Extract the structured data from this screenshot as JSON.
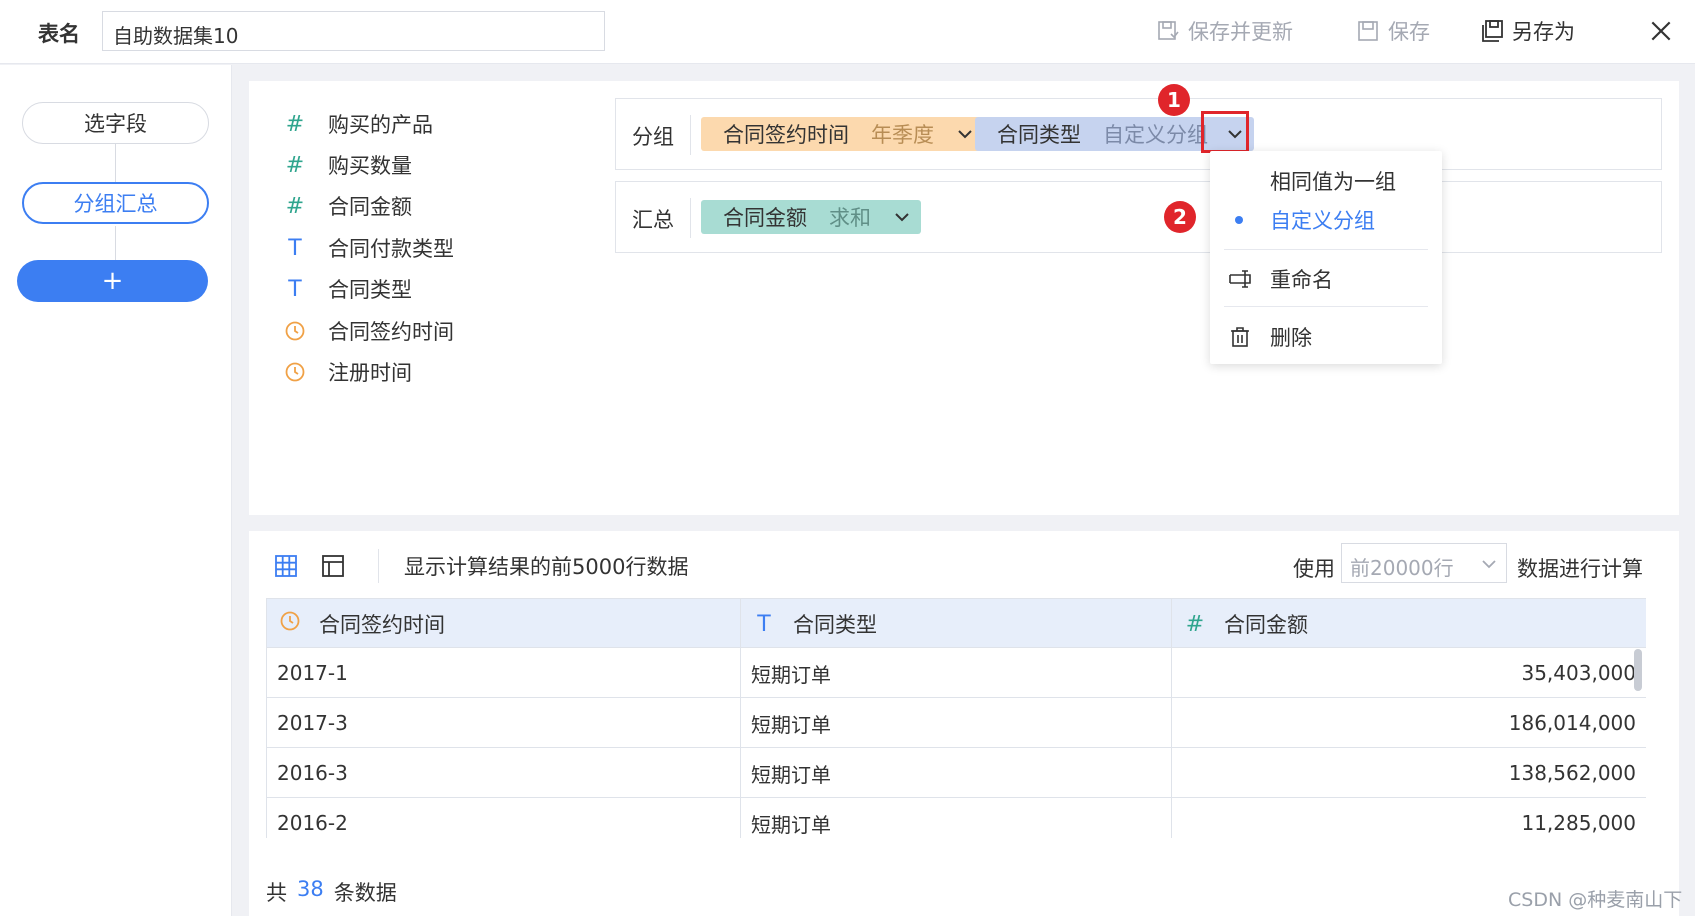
{
  "topbar": {
    "name_label": "表名",
    "name_value": "自助数据集10",
    "save_update": "保存并更新",
    "save": "保存",
    "save_as": "另存为"
  },
  "steps": [
    {
      "label": "选字段"
    },
    {
      "label": "分组汇总"
    },
    {
      "label": "+"
    }
  ],
  "fields": [
    {
      "type": "number",
      "icon": "#",
      "name": "购买的产品"
    },
    {
      "type": "number",
      "icon": "#",
      "name": "购买数量"
    },
    {
      "type": "number",
      "icon": "#",
      "name": "合同金额"
    },
    {
      "type": "text",
      "icon": "T",
      "name": "合同付款类型"
    },
    {
      "type": "text",
      "icon": "T",
      "name": "合同类型"
    },
    {
      "type": "date",
      "icon": "clock",
      "name": "合同签约时间"
    },
    {
      "type": "date",
      "icon": "clock",
      "name": "注册时间"
    }
  ],
  "group_row": {
    "label": "分组",
    "chips": [
      {
        "name": "合同签约时间",
        "sub": "年季度",
        "color": "#fcd9ae"
      },
      {
        "name": "合同类型",
        "sub": "自定义分组",
        "color": "#c6d3ef"
      }
    ]
  },
  "summary_row": {
    "label": "汇总",
    "chips": [
      {
        "name": "合同金额",
        "sub": "求和",
        "color": "#a8dcd3"
      }
    ]
  },
  "annotations": {
    "badge1": "1",
    "badge2": "2"
  },
  "menu": {
    "items": [
      {
        "label": "相同值为一组",
        "selected": false
      },
      {
        "label": "自定义分组",
        "selected": true
      },
      {
        "label": "重命名",
        "icon": "rename-icon"
      },
      {
        "label": "删除",
        "icon": "trash-icon"
      }
    ]
  },
  "preview": {
    "desc": "显示计算结果的前5000行数据",
    "use_label": "使用",
    "rows_select": "前20000行",
    "after_label": "数据进行计算",
    "columns": [
      {
        "type": "date",
        "name": "合同签约时间"
      },
      {
        "type": "text",
        "icon": "T",
        "name": "合同类型"
      },
      {
        "type": "number",
        "icon": "#",
        "name": "合同金额"
      }
    ],
    "rows": [
      [
        "2017-1",
        "短期订单",
        "35,403,000"
      ],
      [
        "2017-3",
        "短期订单",
        "186,014,000"
      ],
      [
        "2016-3",
        "短期订单",
        "138,562,000"
      ],
      [
        "2016-2",
        "短期订单",
        "11,285,000"
      ]
    ],
    "total_prefix": "共",
    "total_count": "38",
    "total_suffix": "条数据"
  },
  "watermark": "CSDN @种麦南山下",
  "colors": {
    "accent": "#3c7ef2",
    "highlight": "#e0252b",
    "number_icon": "#2fa58e",
    "date_icon": "#f0a146"
  }
}
